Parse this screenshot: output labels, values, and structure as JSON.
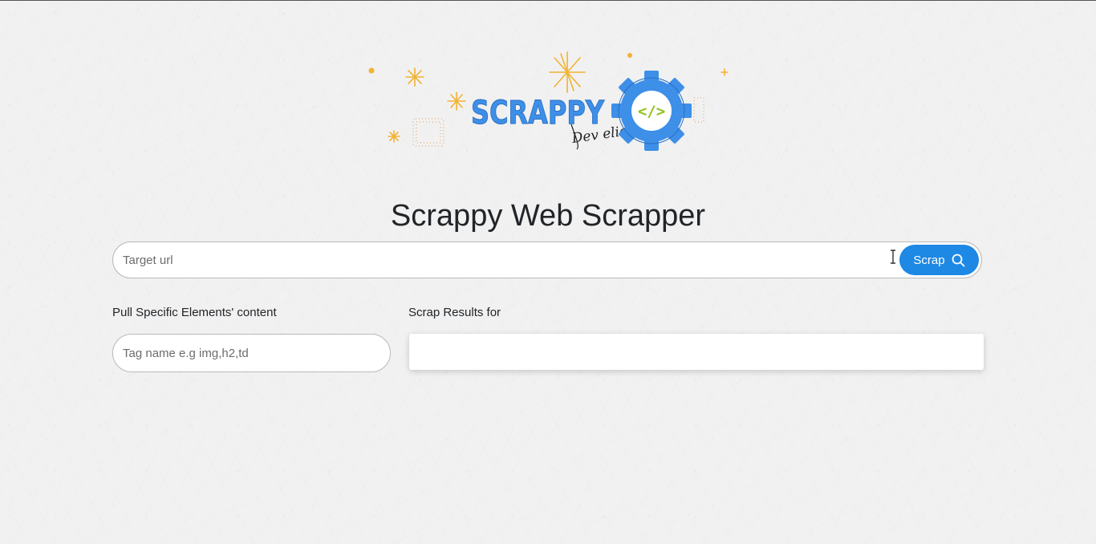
{
  "logo": {
    "wordmark": "SCRAPPY",
    "signature": "Dev elie",
    "gear_glyph": "</>",
    "brand_color": "#3d8fe8",
    "accent_color": "#8fc21b",
    "spark_color": "#f2b233"
  },
  "page": {
    "title": "Scrappy Web Scrapper"
  },
  "url_search": {
    "placeholder": "Target url",
    "value": "",
    "button_label": "Scrap",
    "button_icon": "search-icon",
    "button_color": "#1e88e5"
  },
  "filter": {
    "label": "Pull Specific Elements' content",
    "placeholder": "Tag name e.g img,h2,td",
    "value": ""
  },
  "results": {
    "label": "Scrap Results for"
  }
}
